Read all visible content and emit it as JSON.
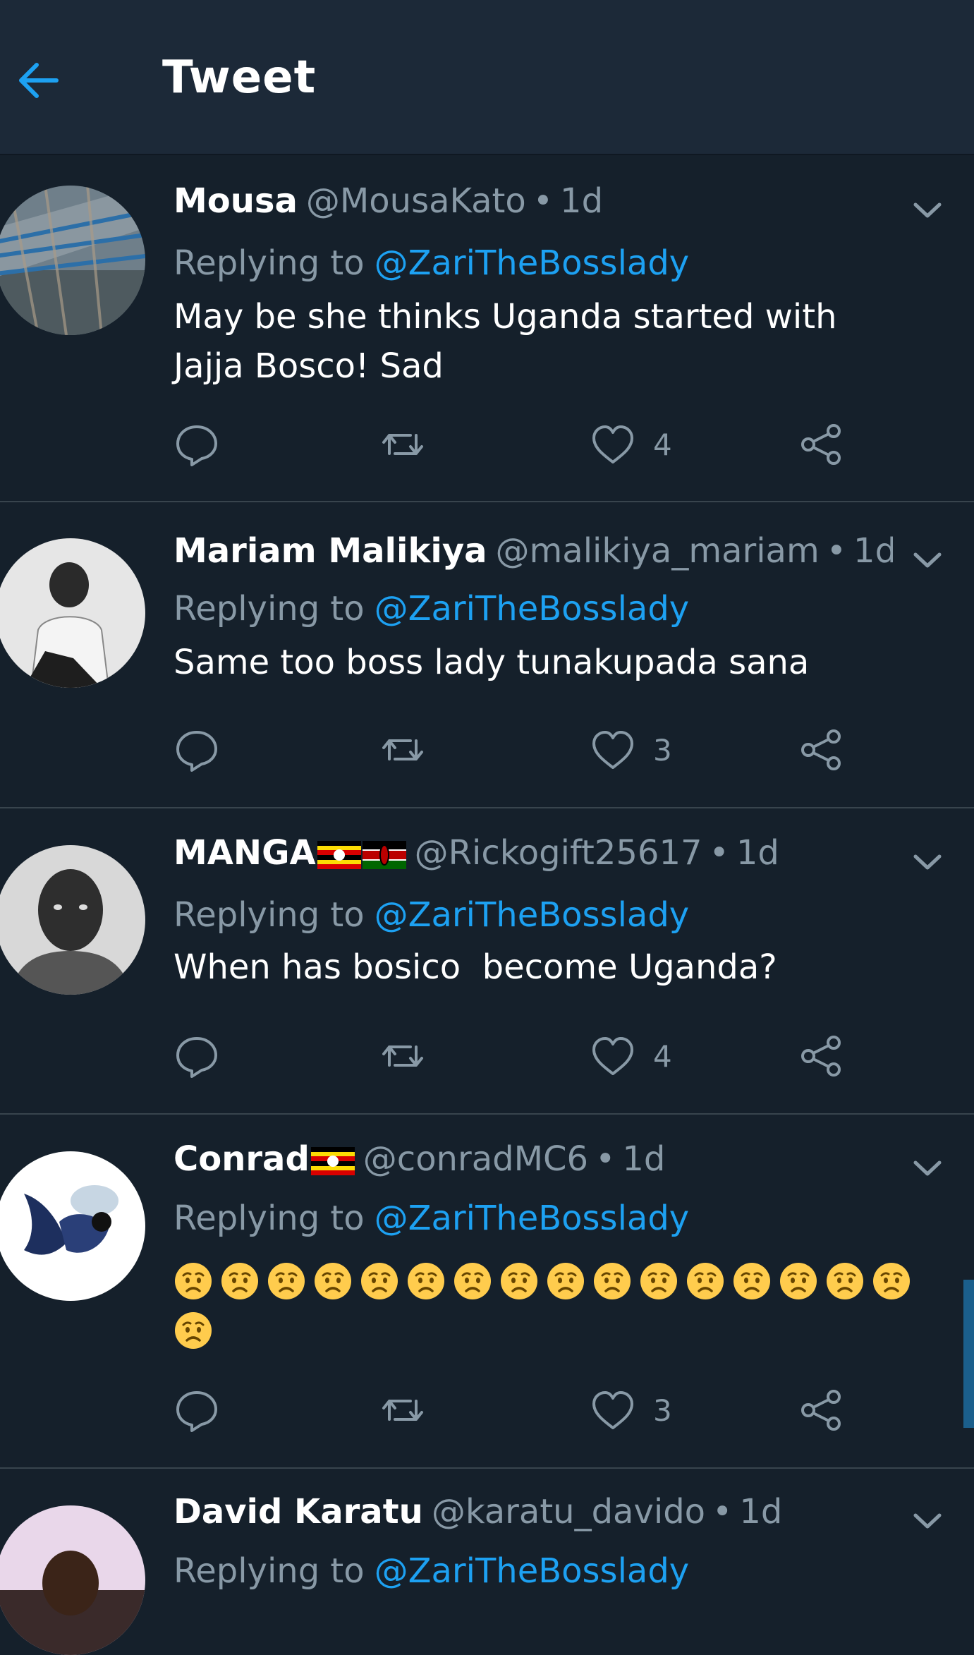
{
  "header": {
    "title": "Tweet",
    "back_icon": "arrow-left-icon",
    "accent": "#1da1f2"
  },
  "colors": {
    "background": "#15202b",
    "topbar": "#1c2938",
    "muted": "#8899a6",
    "link": "#1da1f2",
    "divider": "#38444d"
  },
  "replying_label": "Replying to",
  "tweets": [
    {
      "name": "Mousa",
      "handle": "@MousaKato",
      "dot": "•",
      "time": "1d",
      "mention": "@ZariTheBosslady",
      "text": "May be she thinks Uganda started with Jajja Bosco! Sad",
      "likes": "4"
    },
    {
      "name": "Mariam Malikiya",
      "handle": "@malikiya_mariam",
      "dot": "•",
      "time": "1d",
      "mention": "@ZariTheBosslady",
      "text": "Same too boss lady tunakupada sana",
      "likes": "3"
    },
    {
      "name": "MANGA",
      "flags": [
        "uganda-flag-icon",
        "kenya-flag-icon"
      ],
      "handle": "@Rickogift25617",
      "dot": "•",
      "time": "1d",
      "mention": "@ZariTheBosslady",
      "text": "When has bosico  become Uganda?",
      "likes": "4"
    },
    {
      "name": "Conrad",
      "flags": [
        "uganda-flag-icon"
      ],
      "handle": "@conradMC6",
      "dot": "•",
      "time": "1d",
      "mention": "@ZariTheBosslady",
      "text_emoji": "worried-face-icon",
      "emoji_count": 17,
      "likes": "3"
    },
    {
      "name": "David Karatu",
      "handle": "@karatu_davido",
      "dot": "•",
      "time": "1d",
      "mention": "@ZariTheBosslady"
    }
  ],
  "action_icons": [
    "reply-icon",
    "retweet-icon",
    "like-icon",
    "share-icon"
  ]
}
